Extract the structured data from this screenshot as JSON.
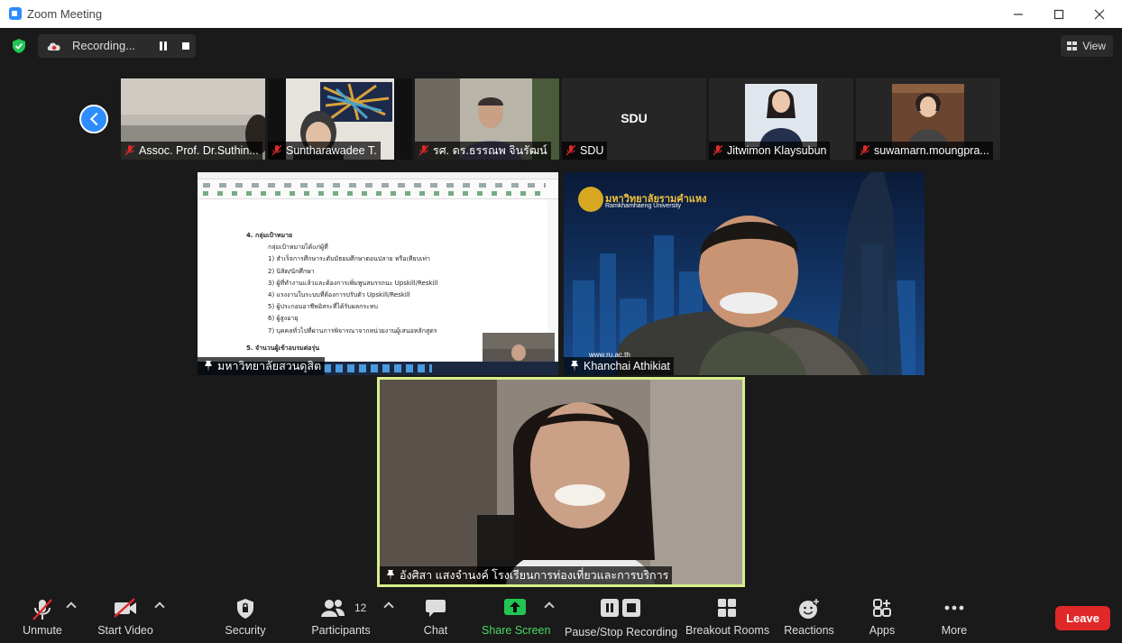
{
  "window": {
    "title": "Zoom Meeting"
  },
  "topbar": {
    "recording_label": "Recording...",
    "view_label": "View"
  },
  "thumbnails": [
    {
      "name": "Assoc. Prof. Dr.Suthin..."
    },
    {
      "name": "Suntharawadee T."
    },
    {
      "name": "รศ. ดร.ธรรณพ จินรัฒน์"
    },
    {
      "name": "SDU",
      "center_label": "SDU"
    },
    {
      "name": "Jitwimon Klaysubun"
    },
    {
      "name": "suwamarn.moungpra..."
    }
  ],
  "tiles": {
    "share": {
      "name": "มหาวิทยาลัยสวนดุสิต"
    },
    "khanchai": {
      "name": "Khanchai Athikiat",
      "banner_th": "มหาวิทยาลัยรามคำแหง",
      "banner_en": "Ramkhamhaeng University",
      "url": "www.ru.ac.th"
    },
    "active": {
      "name": "อังศิสา แสงจำนงค์ โรงเรียนการท่องเที่ยวและการบริการ"
    }
  },
  "doc": {
    "heading": "4. กลุ่มเป้าหมาย",
    "intro": "กลุ่มเป้าหมายได้แก่ผู้ที่",
    "items": [
      "1)  สำเร็จการศึกษาระดับมัธยมศึกษาตอนปลาย หรือเทียบเท่า",
      "2)  นิสิต/นักศึกษา",
      "3)  ผู้ที่ทำงานแล้วและต้องการเพิ่มพูนสมรรถนะ Upskill/Reskill",
      "4)  แรงงานในระบบที่ต้องการปรับตัว Upskill/Reskill",
      "5)  ผู้ประกอบอาชีพอิสระที่ได้รับผลกระทบ",
      "6)  ผู้สูงอายุ",
      "7)  บุคคลทั่วไปที่ผ่านการพิจารณาจากหน่วยงานผู้เสนอหลักสูตร"
    ],
    "heading2": "5. จำนวนผู้เข้าอบรมต่อรุ่น"
  },
  "toolbar": {
    "unmute": "Unmute",
    "start_video": "Start Video",
    "security": "Security",
    "participants": "Participants",
    "participants_count": "12",
    "chat": "Chat",
    "share_screen": "Share Screen",
    "pause_stop": "Pause/Stop Recording",
    "breakout": "Breakout Rooms",
    "reactions": "Reactions",
    "apps": "Apps",
    "more": "More",
    "leave": "Leave"
  },
  "colors": {
    "accent": "#2d8cff",
    "leave": "#e02828",
    "active_border": "#d8ef8a",
    "share_green": "#4ad864"
  }
}
